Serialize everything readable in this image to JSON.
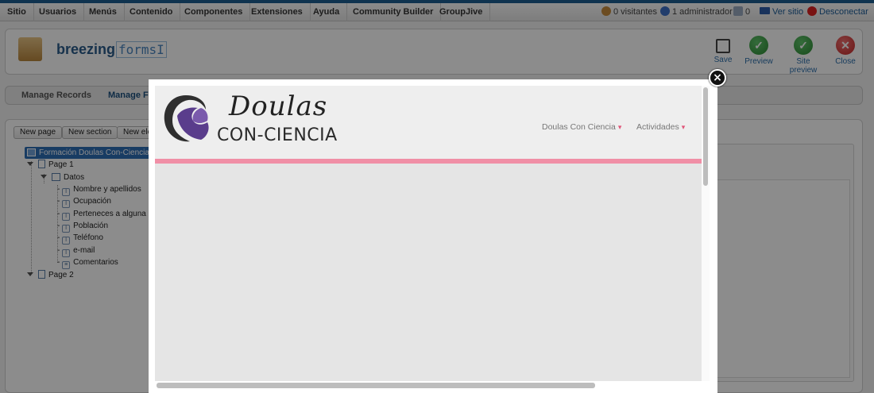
{
  "menu": {
    "items": [
      "Sitio",
      "Usuarios",
      "Menús",
      "Contenido",
      "Componentes",
      "Extensiones",
      "Ayuda",
      "Community Builder",
      "GroupJive"
    ]
  },
  "status": {
    "visitors": "0 visitantes",
    "admins": "1 administrador",
    "messages": "0",
    "view_site": "Ver sitio",
    "logout": "Desconectar"
  },
  "header": {
    "logo_a": "breezing",
    "logo_b": "formsI"
  },
  "toolbar": {
    "save": "Save",
    "preview": "Preview",
    "site_preview": "Site preview",
    "close": "Close"
  },
  "subtabs": {
    "records": "Manage Records",
    "forms": "Manage Fo"
  },
  "builder": {
    "new_page": "New page",
    "new_section": "New section",
    "new_element": "New ele",
    "tree": {
      "form": "Formación Doulas Con-Ciencia",
      "page1": "Page 1",
      "section": "Datos",
      "fields": [
        "Nombre y apellidos",
        "Ocupación",
        "Perteneces a alguna",
        "Población",
        "Teléfono",
        "e-mail",
        "Comentarios"
      ],
      "page2": "Page 2"
    }
  },
  "modal": {
    "close_glyph": "×",
    "site": {
      "logo_script": "Doulas",
      "logo_caps": "CON-CIENCIA",
      "nav": [
        "Doulas Con Ciencia",
        "Actividades"
      ]
    }
  },
  "colors": {
    "accent_pink": "#f08fa6",
    "logo_purple": "#5a3d8c",
    "admin_blue": "#1d5d90"
  }
}
